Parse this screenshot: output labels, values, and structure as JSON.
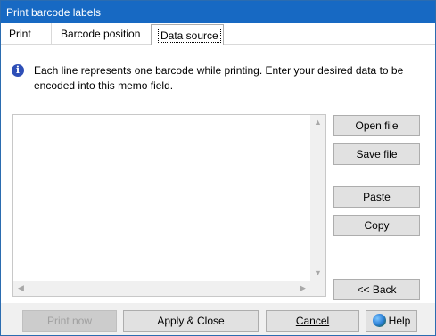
{
  "window": {
    "title": "Print barcode labels"
  },
  "tabs": [
    {
      "label": "Print"
    },
    {
      "label": "Barcode position"
    },
    {
      "label": "Data source"
    }
  ],
  "info": {
    "icon": "info-icon",
    "text": "Each line represents one barcode while printing. Enter your desired data to be encoded into this memo field."
  },
  "memo": {
    "value": ""
  },
  "side_buttons": {
    "open_file": "Open file",
    "save_file": "Save file",
    "paste": "Paste",
    "copy": "Copy",
    "back": "<< Back"
  },
  "footer": {
    "print_now": "Print now",
    "apply_close": "Apply & Close",
    "cancel": "Cancel",
    "help": "Help"
  },
  "colors": {
    "titlebar": "#1769c3",
    "info_icon": "#2e4fb7"
  }
}
